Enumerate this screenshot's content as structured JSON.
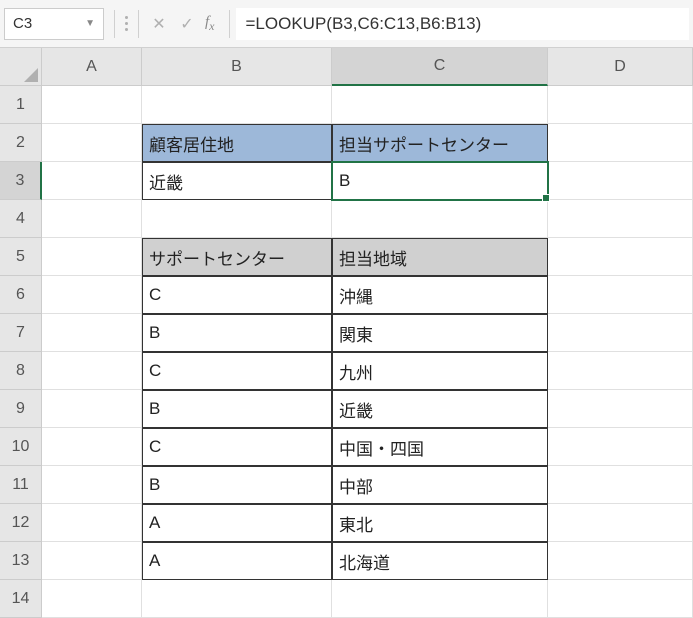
{
  "name_box": "C3",
  "formula": "=LOOKUP(B3,C6:C13,B6:B13)",
  "columns": [
    "A",
    "B",
    "C",
    "D"
  ],
  "rows": [
    "1",
    "2",
    "3",
    "4",
    "5",
    "6",
    "7",
    "8",
    "9",
    "10",
    "11",
    "12",
    "13",
    "14"
  ],
  "headers1": {
    "b": "顧客居住地",
    "c": "担当サポートセンター"
  },
  "values1": {
    "b": "近畿",
    "c": "B"
  },
  "headers2": {
    "b": "サポートセンター",
    "c": "担当地域"
  },
  "table2": [
    {
      "b": "C",
      "c": "沖縄"
    },
    {
      "b": "B",
      "c": "関東"
    },
    {
      "b": "C",
      "c": "九州"
    },
    {
      "b": "B",
      "c": "近畿"
    },
    {
      "b": "C",
      "c": "中国・四国"
    },
    {
      "b": "B",
      "c": "中部"
    },
    {
      "b": "A",
      "c": "東北"
    },
    {
      "b": "A",
      "c": "北海道"
    }
  ]
}
